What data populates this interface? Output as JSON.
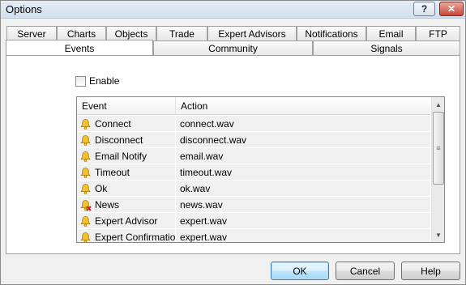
{
  "window": {
    "title": "Options",
    "help_glyph": "?",
    "close_glyph": "✕"
  },
  "tabs": {
    "row1": [
      "Server",
      "Charts",
      "Objects",
      "Trade",
      "Expert Advisors",
      "Notifications",
      "Email",
      "FTP"
    ],
    "row2": [
      "Events",
      "Community",
      "Signals"
    ],
    "active": "Events"
  },
  "enable": {
    "label": "Enable",
    "checked": false
  },
  "list": {
    "columns": [
      "Event",
      "Action"
    ],
    "rows": [
      {
        "event": "Connect",
        "action": "connect.wav",
        "icon": "bell-icon"
      },
      {
        "event": "Disconnect",
        "action": "disconnect.wav",
        "icon": "bell-icon"
      },
      {
        "event": "Email Notify",
        "action": "email.wav",
        "icon": "bell-icon"
      },
      {
        "event": "Timeout",
        "action": "timeout.wav",
        "icon": "bell-icon"
      },
      {
        "event": "Ok",
        "action": "ok.wav",
        "icon": "bell-icon"
      },
      {
        "event": "News",
        "action": "news.wav",
        "icon": "bell-disabled-icon"
      },
      {
        "event": "Expert Advisor",
        "action": "expert.wav",
        "icon": "bell-icon"
      },
      {
        "event": "Expert Confirmation",
        "action": "expert.wav",
        "icon": "bell-icon"
      }
    ]
  },
  "buttons": {
    "ok": "OK",
    "cancel": "Cancel",
    "help": "Help"
  },
  "colors": {
    "bell": "#f2c12e",
    "disabled_mark": "#d21f1f",
    "row_bg": "#f0f0f0"
  }
}
